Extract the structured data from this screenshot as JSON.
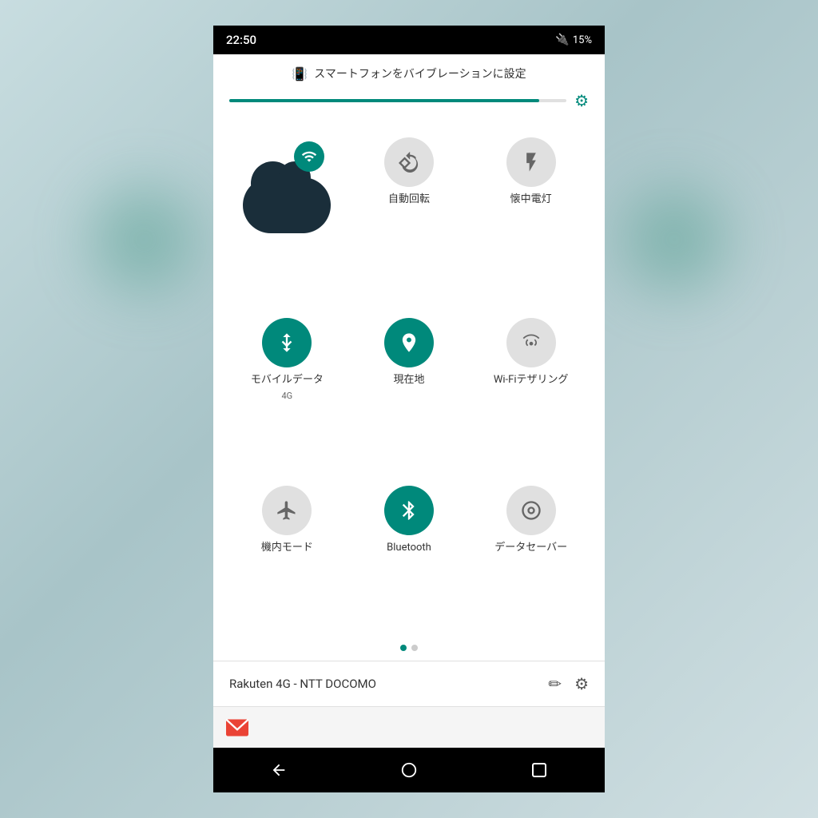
{
  "statusBar": {
    "time": "22:50",
    "battery": "15%",
    "batteryIcon": "🔋"
  },
  "vibrateBanner": {
    "text": "スマートフォンをバイブレーションに設定",
    "icon": "📳"
  },
  "brightness": {
    "fillPercent": 92
  },
  "tiles": [
    {
      "id": "wifi",
      "label": "Wi-Fi",
      "sublabel": "",
      "active": true,
      "type": "wifi-big"
    },
    {
      "id": "auto-rotate",
      "label": "自動回転",
      "sublabel": "",
      "active": false,
      "type": "normal"
    },
    {
      "id": "flashlight",
      "label": "懐中電灯",
      "sublabel": "",
      "active": false,
      "type": "normal"
    },
    {
      "id": "mobile-data",
      "label": "モバイルデータ",
      "sublabel": "4G",
      "active": true,
      "type": "normal"
    },
    {
      "id": "location",
      "label": "現在地",
      "sublabel": "",
      "active": true,
      "type": "normal"
    },
    {
      "id": "wifi-tethering",
      "label": "Wi-Fiテザリング",
      "sublabel": "",
      "active": false,
      "type": "normal"
    },
    {
      "id": "airplane",
      "label": "機内モード",
      "sublabel": "",
      "active": false,
      "type": "normal"
    },
    {
      "id": "bluetooth",
      "label": "Bluetooth",
      "sublabel": "",
      "active": true,
      "type": "normal"
    },
    {
      "id": "data-saver",
      "label": "データセーバー",
      "sublabel": "",
      "active": false,
      "type": "normal"
    }
  ],
  "pagination": {
    "current": 0,
    "total": 2
  },
  "network": {
    "name": "Rakuten 4G - NTT DOCOMO",
    "editLabel": "✏",
    "settingsLabel": "⚙"
  },
  "navigation": {
    "back": "◀",
    "home": "●",
    "recent": "■"
  }
}
